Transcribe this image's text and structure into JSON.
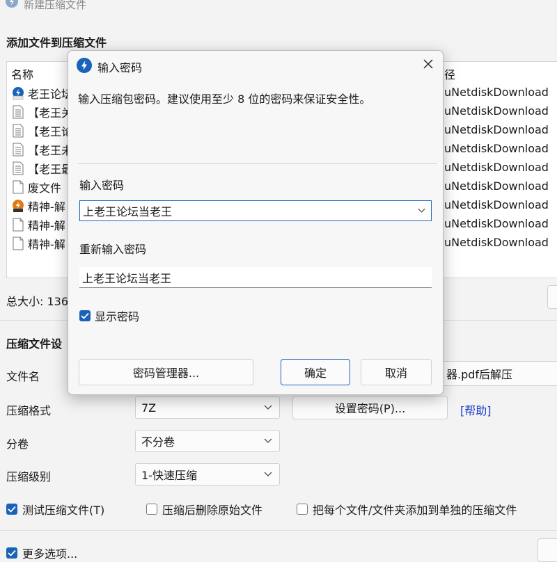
{
  "app": {
    "window_title": "新建压缩文件"
  },
  "files": {
    "heading": "添加文件到压缩文件",
    "columns": {
      "name": "名称",
      "path": "径"
    },
    "rows": [
      {
        "name": "老王论坛",
        "icon": "bandizip-archive-icon",
        "path": "uNetdiskDownload"
      },
      {
        "name": "【老王关",
        "icon": "document-icon",
        "path": "uNetdiskDownload"
      },
      {
        "name": "【老王论",
        "icon": "document-icon",
        "path": "uNetdiskDownload"
      },
      {
        "name": "【老王未",
        "icon": "document-icon",
        "path": "uNetdiskDownload"
      },
      {
        "name": "【老王最",
        "icon": "document-icon",
        "path": "uNetdiskDownload"
      },
      {
        "name": "废文件",
        "icon": "blank-file-icon",
        "path": "uNetdiskDownload"
      },
      {
        "name": "精神-解",
        "icon": "split-archive-icon",
        "path": "uNetdiskDownload"
      },
      {
        "name": "精神-解",
        "icon": "blank-file-icon",
        "path": "uNetdiskDownload"
      },
      {
        "name": "精神-解",
        "icon": "blank-file-icon",
        "path": "uNetdiskDownload"
      }
    ],
    "total_size": "总大小: 136"
  },
  "settings": {
    "heading": "压缩文件设",
    "filename_label": "文件名",
    "filename_value": "器.pdf后解压",
    "format_label": "压缩格式",
    "format_value": "7Z",
    "set_password_button": "设置密码(P)...",
    "help_link": "[帮助]",
    "split_label": "分卷",
    "split_value": "不分卷",
    "level_label": "压缩级别",
    "level_value": "1-快速压缩",
    "test_archive": {
      "label": "测试压缩文件(T)",
      "checked": true
    },
    "delete_after": {
      "label": "压缩后删除原始文件",
      "checked": false
    },
    "each_separate": {
      "label": "把每个文件/文件夹添加到单独的压缩文件",
      "checked": false
    },
    "more_options": {
      "label": "更多选项...",
      "checked": true
    }
  },
  "dialog": {
    "title": "输入密码",
    "description": "输入压缩包密码。建议使用至少 8 位的密码来保证安全性。",
    "password_label": "输入密码",
    "password_value": "上老王论坛当老王",
    "confirm_label": "重新输入密码",
    "confirm_value": "上老王论坛当老王",
    "show_password": {
      "label": "显示密码",
      "checked": true
    },
    "manager_button": "密码管理器...",
    "ok_button": "确定",
    "cancel_button": "取消"
  },
  "colors": {
    "accent": "#1a62b8",
    "focus_border": "#1a62b8",
    "link": "#1c3fc9"
  }
}
